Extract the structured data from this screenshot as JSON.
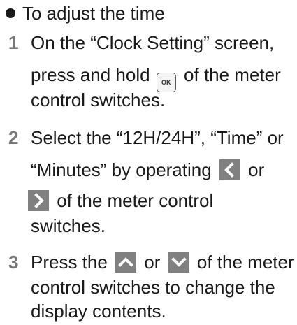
{
  "heading": "To adjust the time",
  "steps": [
    {
      "num": "1",
      "l1": "On the “Clock Setting” screen,",
      "l2a": "press and hold",
      "l2b": "of the meter",
      "l3": "control switches."
    },
    {
      "num": "2",
      "l1": "Select the “12H/24H”, “Time” or",
      "l2a": "“Minutes” by operating",
      "l2b": "or",
      "l3": "of the meter control",
      "l4": "switches."
    },
    {
      "num": "3",
      "l1a": "Press the",
      "l1b": "or",
      "l1c": "of the meter",
      "l2": "control switches to change the",
      "l3": "display contents."
    }
  ],
  "keys": {
    "ok": "OK"
  },
  "colors": {
    "key_gray": "#808080",
    "step_number": "#777777"
  },
  "icons": [
    "ok-button-icon",
    "left-arrow-icon",
    "right-arrow-icon",
    "up-arrow-icon",
    "down-arrow-icon"
  ]
}
